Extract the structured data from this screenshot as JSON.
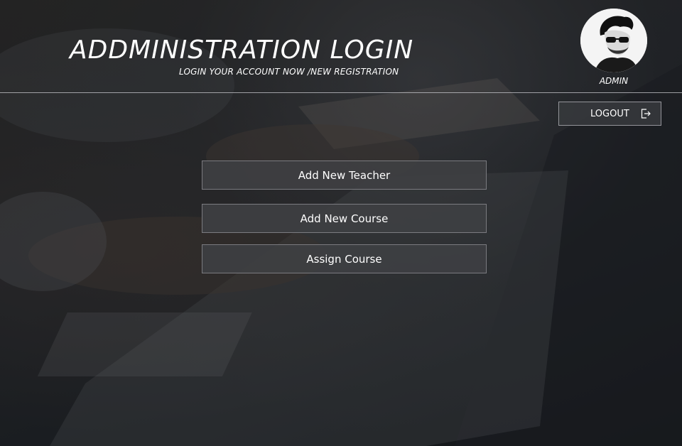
{
  "header": {
    "title": "ADDMINISTRATION LOGIN",
    "subtitle": "LOGIN YOUR ACCOUNT NOW /NEW REGISTRATION"
  },
  "user": {
    "label": "ADMIN",
    "avatar_icon": "user-avatar-photo"
  },
  "logout": {
    "label": "LOGOUT",
    "icon": "sign-out-icon"
  },
  "menu": {
    "items": [
      {
        "label": "Add New Teacher"
      },
      {
        "label": "Add New Course"
      },
      {
        "label": "Assign Course"
      }
    ]
  },
  "colors": {
    "text": "#ffffff",
    "button_bg": "#3e3f42",
    "background": "#1b1e22"
  }
}
